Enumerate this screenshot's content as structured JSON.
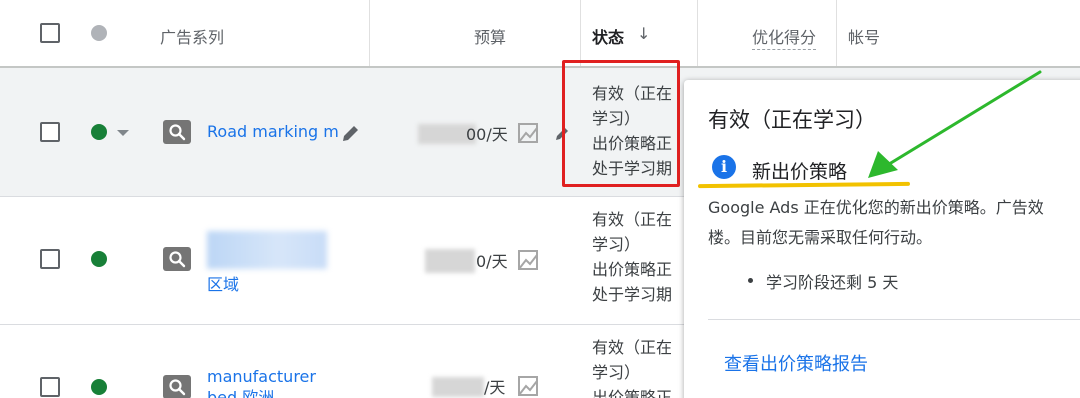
{
  "header": {
    "campaign": "广告系列",
    "budget": "预算",
    "status": "状态",
    "status_sort": "↓",
    "optimization_score": "优化得分",
    "account": "帐号"
  },
  "rows": [
    {
      "campaign_name": "Road marking m",
      "budget_suffix": "00/天",
      "status_lines": [
        "有效（正在",
        "学习）",
        "出价策略正",
        "处于学习期"
      ]
    },
    {
      "campaign_name": "区域",
      "budget_suffix": "0/天",
      "status_lines": [
        "有效（正在",
        "学习）",
        "出价策略正",
        "处于学习期"
      ]
    },
    {
      "campaign_name_lines": [
        "manufacturer",
        "bed 欧洲"
      ],
      "budget_suffix": "/天",
      "status_lines": [
        "有效（正在",
        "学习）",
        "出价策略正"
      ]
    }
  ],
  "popover": {
    "title": "有效（正在学习）",
    "info_icon_glyph": "i",
    "heading": "新出价策略",
    "desc_lines": [
      "Google Ads 正在优化您的新出价策略。广告效",
      "楼。目前您无需采取任何行动。"
    ],
    "bullet": "学习阶段还剩 5 天",
    "link": "查看出价策略报告"
  },
  "colors": {
    "accent": "#1a73e8",
    "status_green": "#188038",
    "annotation_red": "#e02020",
    "annotation_yellow": "#f2c200",
    "annotation_arrow": "#2db82d"
  }
}
